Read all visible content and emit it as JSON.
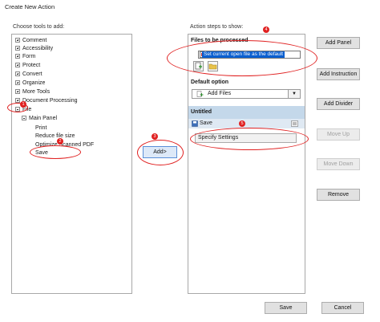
{
  "window": {
    "title": "Create New Action"
  },
  "left": {
    "label": "Choose tools to add:",
    "items": [
      {
        "label": "Comment",
        "toggle": "plus"
      },
      {
        "label": "Accessibility",
        "toggle": "plus"
      },
      {
        "label": "Form",
        "toggle": "plus"
      },
      {
        "label": "Protect",
        "toggle": "plus"
      },
      {
        "label": "Convert",
        "toggle": "plus"
      },
      {
        "label": "Organize",
        "toggle": "plus"
      },
      {
        "label": "More Tools",
        "toggle": "plus"
      },
      {
        "label": "Document Processing",
        "toggle": "plus"
      },
      {
        "label": "File",
        "toggle": "minus"
      },
      {
        "label": "Main Panel",
        "toggle": "minus"
      },
      {
        "label": "Print",
        "toggle": "none"
      },
      {
        "label": "Reduce file size",
        "toggle": "none"
      },
      {
        "label": "Optimize Scanned PDF",
        "toggle": "none"
      },
      {
        "label": "Save",
        "toggle": "none"
      }
    ]
  },
  "add_button": {
    "label": "Add>"
  },
  "right": {
    "label": "Action steps to show:",
    "files_header": "Files to be processed",
    "files_option": "Set current open file as the default",
    "default_header": "Default option",
    "add_files_label": "Add Files",
    "dropdown_arrow": "▼",
    "untitled_header": "Untitled",
    "save_step": "Save",
    "specify_settings": "Specify Settings"
  },
  "side_buttons": {
    "add_panel": "Add Panel",
    "add_instruction": "Add Instruction",
    "add_divider": "Add Divider",
    "move_up": "Move Up",
    "move_down": "Move Down",
    "remove": "Remove"
  },
  "bottom_buttons": {
    "save": "Save",
    "cancel": "Cancel"
  },
  "annotations": {
    "badge_1": "1",
    "badge_2": "2",
    "badge_3": "3",
    "badge_4": "4",
    "badge_5": "5"
  },
  "colors": {
    "selection_blue": "#0a5fd0",
    "section_header": "#c4d8ea",
    "annotation_red": "#e02020",
    "add_button_highlight": "#dde9f8"
  }
}
